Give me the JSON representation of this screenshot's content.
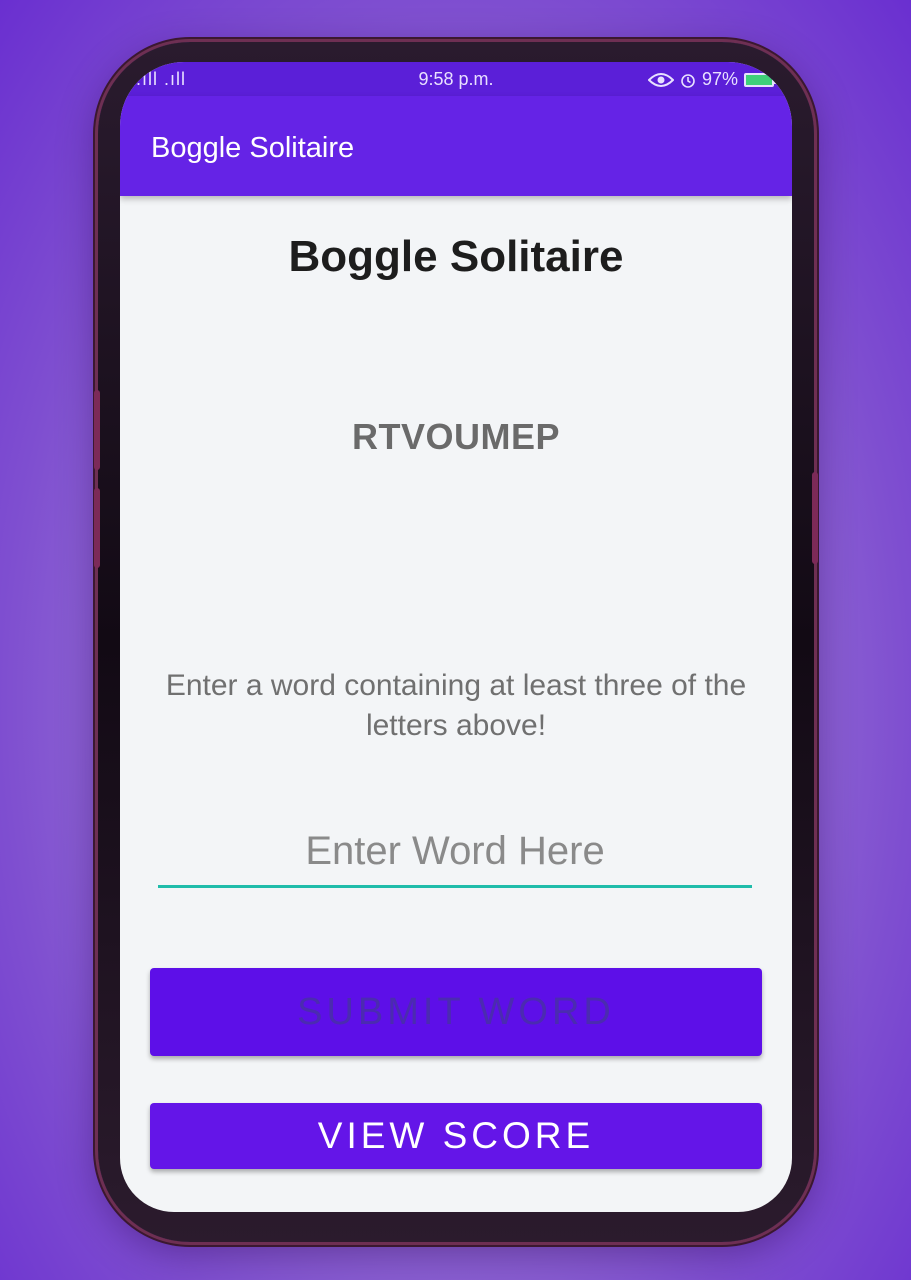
{
  "status_bar": {
    "signal": ".ıll .ıll",
    "time": "9:58 p.m.",
    "battery": "97%"
  },
  "app_bar": {
    "title": "Boggle Solitaire"
  },
  "main": {
    "title": "Boggle Solitaire",
    "letters": "RTVOUMEP",
    "instructions": "Enter a word containing at least three of the letters above!",
    "word_input": {
      "placeholder": "Enter Word Here",
      "value": ""
    },
    "submit_label": "SUBMIT WORD",
    "view_score_label": "VIEW SCORE"
  },
  "colors": {
    "primary": "#6523e6",
    "button": "#5d0fe8",
    "accent": "#1fbcaa"
  }
}
